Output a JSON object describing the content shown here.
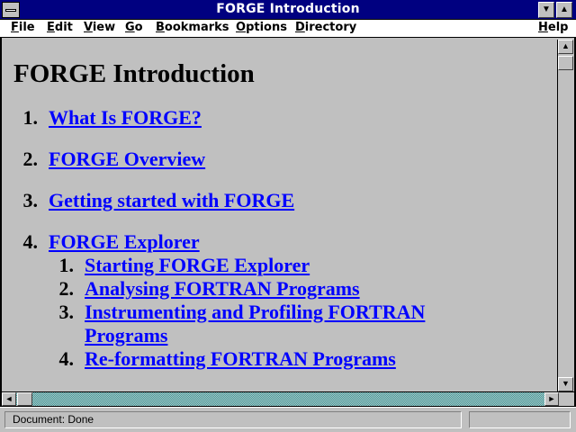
{
  "window": {
    "title": "FORGE Introduction",
    "minimize_glyph": "▼",
    "maximize_glyph": "▲"
  },
  "menubar": {
    "items": [
      {
        "label": "File",
        "underline": "F"
      },
      {
        "label": "Edit",
        "underline": "E"
      },
      {
        "label": "View",
        "underline": "V"
      },
      {
        "label": "Go",
        "underline": "G"
      },
      {
        "label": "Bookmarks",
        "underline": "B"
      },
      {
        "label": "Options",
        "underline": "O"
      },
      {
        "label": "Directory",
        "underline": "D"
      },
      {
        "label": "Help",
        "underline": "H"
      }
    ]
  },
  "page": {
    "title": "FORGE Introduction",
    "toc": [
      {
        "num": "1.",
        "link": "What Is FORGE? "
      },
      {
        "num": "2.",
        "link": "FORGE Overview "
      },
      {
        "num": "3.",
        "link": "Getting started with FORGE "
      },
      {
        "num": "4.",
        "link": "FORGE Explorer ",
        "subitems": [
          {
            "num": "1.",
            "link": "Starting FORGE Explorer "
          },
          {
            "num": "2.",
            "link": "Analysing FORTRAN Programs "
          },
          {
            "num": "3.",
            "link": "Instrumenting and Profiling FORTRAN",
            "link_cont": "Programs "
          },
          {
            "num": "4.",
            "link": "Re-formatting FORTRAN Programs "
          }
        ]
      }
    ]
  },
  "scrollbars": {
    "up_glyph": "▲",
    "down_glyph": "▼",
    "left_glyph": "◄",
    "right_glyph": "►"
  },
  "status": {
    "text": "Document: Done"
  },
  "colors": {
    "title_bar": "#000080",
    "link": "#0000ff",
    "background": "#c0c0c0"
  }
}
